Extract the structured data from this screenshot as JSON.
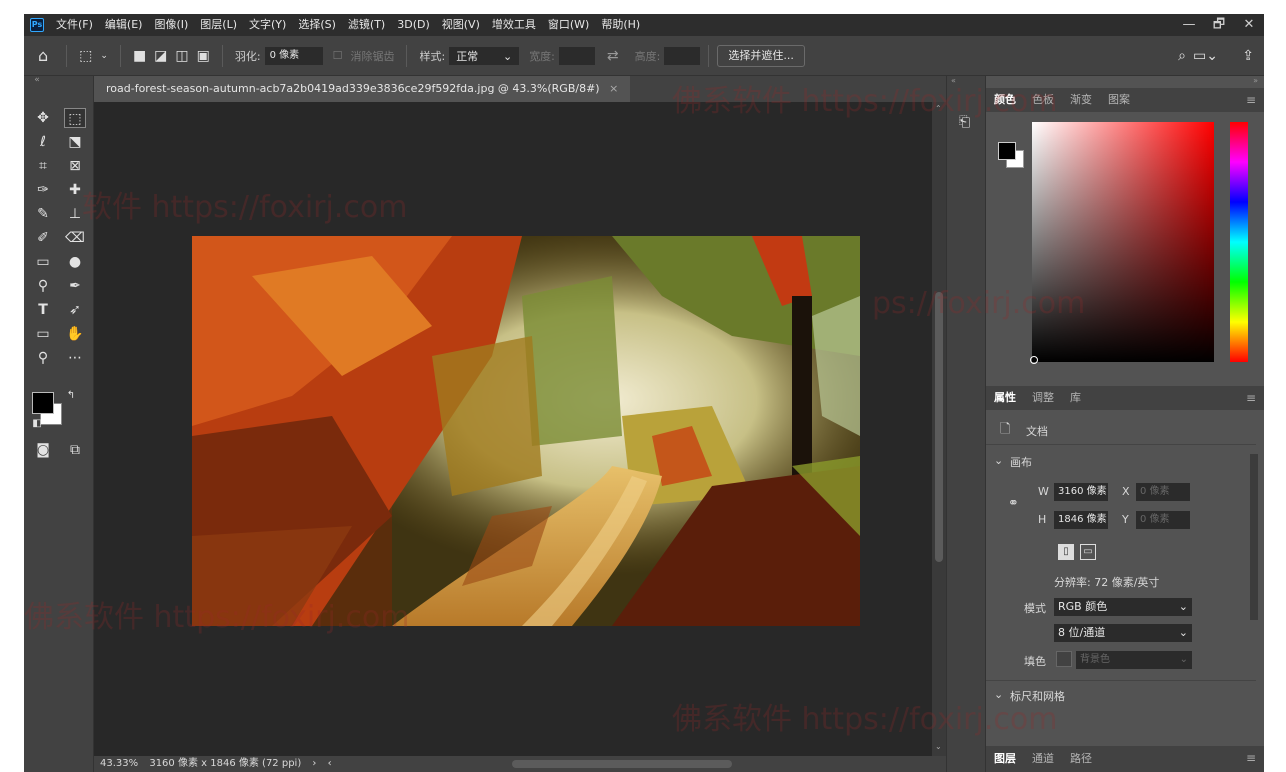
{
  "app": {
    "logo": "Ps"
  },
  "menu": [
    "文件(F)",
    "编辑(E)",
    "图像(I)",
    "图层(L)",
    "文字(Y)",
    "选择(S)",
    "滤镜(T)",
    "3D(D)",
    "视图(V)",
    "增效工具",
    "窗口(W)",
    "帮助(H)"
  ],
  "window_controls": [
    "—",
    "🗗",
    "✕"
  ],
  "options": {
    "feather_label": "羽化:",
    "feather_value": "0 像素",
    "anti_alias_label": "消除锯齿",
    "style_label": "样式:",
    "style_value": "正常",
    "width_label": "宽度:",
    "height_label": "高度:",
    "select_mask_button": "选择并遮住..."
  },
  "document": {
    "tab_title": "road-forest-season-autumn-acb7a2b0419ad339e3836ce29f592fda.jpg @ 43.3%(RGB/8#)",
    "tab_close": "×"
  },
  "status": {
    "zoom": "43.33%",
    "info": "3160 像素 x 1846 像素 (72 ppi)"
  },
  "color_panel": {
    "tabs": [
      "颜色",
      "色板",
      "渐变",
      "图案"
    ],
    "foreground": "#000000",
    "background": "#ffffff"
  },
  "properties_panel": {
    "tabs": [
      "属性",
      "调整",
      "库"
    ],
    "doc_label": "文档",
    "canvas_section": "画布",
    "w_label": "W",
    "w_value": "3160 像素",
    "x_label": "X",
    "x_placeholder": "0 像素",
    "h_label": "H",
    "h_value": "1846 像素",
    "y_label": "Y",
    "y_placeholder": "0 像素",
    "resolution": "分辨率: 72 像素/英寸",
    "mode_label": "模式",
    "mode_value": "RGB 颜色",
    "depth_value": "8 位/通道",
    "fill_label": "填色",
    "fill_value": "背景色",
    "rulers_section": "标尺和网格"
  },
  "layers_panel": {
    "tabs": [
      "图层",
      "通道",
      "路径"
    ]
  },
  "watermarks": [
    "佛系软件 https://foxirj.com",
    "软件 https://foxirj.com",
    "佛系软件 https://foxirj.com",
    "ps://foxirj.com",
    "佛系软件 https://foxirj.com"
  ]
}
